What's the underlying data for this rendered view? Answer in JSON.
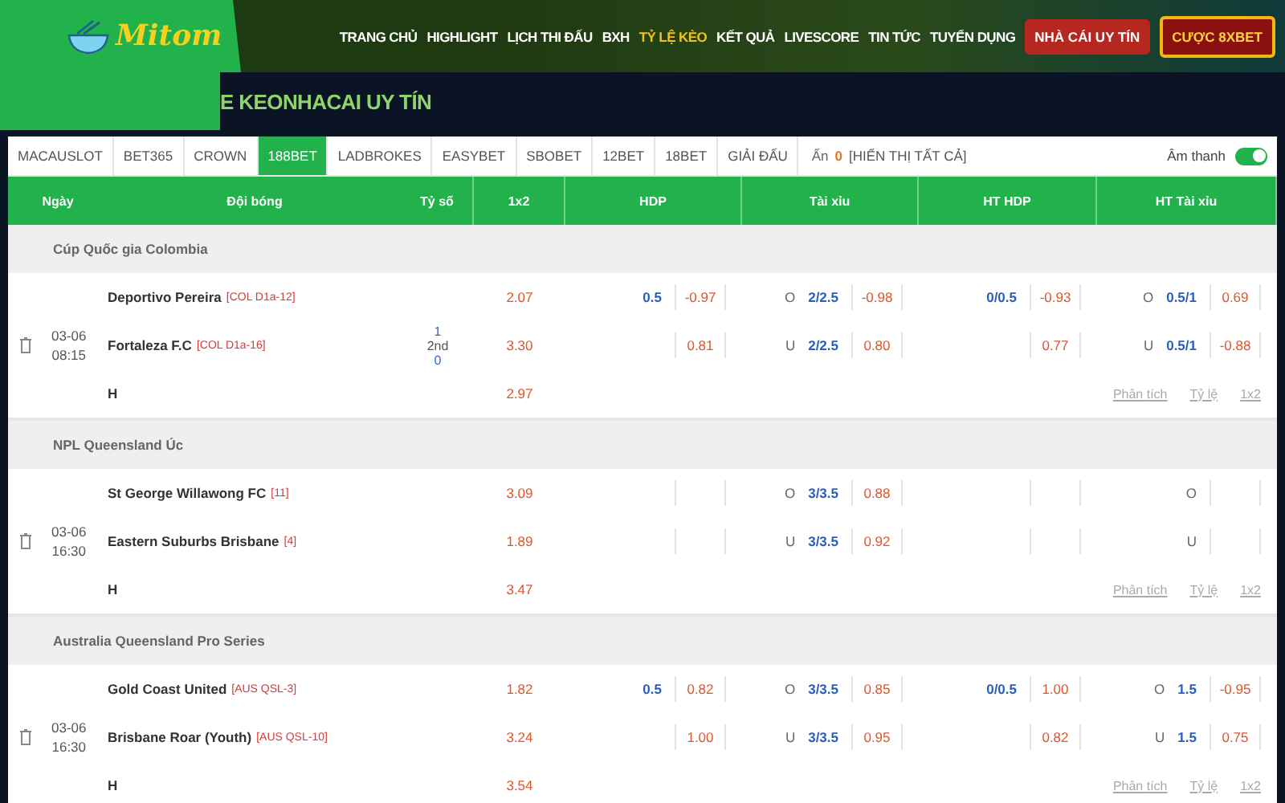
{
  "logo": {
    "text": "Mitom"
  },
  "nav": [
    {
      "label": "TRANG CHỦ",
      "selected": false
    },
    {
      "label": "HIGHLIGHT",
      "selected": false
    },
    {
      "label": "LỊCH THI ĐẤU",
      "selected": false
    },
    {
      "label": "BXH",
      "selected": false
    },
    {
      "label": "TỶ LỆ KÈO",
      "selected": true
    },
    {
      "label": "KẾT QUẢ",
      "selected": false
    },
    {
      "label": "LIVESCORE",
      "selected": false
    },
    {
      "label": "TIN TỨC",
      "selected": false
    },
    {
      "label": "TUYỂN DỤNG",
      "selected": false
    }
  ],
  "header_buttons": [
    {
      "label": "NHÀ CÁI UY TÍN",
      "kind": "primary"
    },
    {
      "label": "CƯỢC 8XBET",
      "kind": "promo"
    }
  ],
  "banner": {
    "title": "E KEONHACAI UY TÍN"
  },
  "tabs": [
    {
      "label": "MACAUSLOT",
      "selected": false
    },
    {
      "label": "BET365",
      "selected": false
    },
    {
      "label": "CROWN",
      "selected": false
    },
    {
      "label": "188BET",
      "selected": true
    },
    {
      "label": "LADBROKES",
      "selected": false
    },
    {
      "label": "EASYBET",
      "selected": false
    },
    {
      "label": "SBOBET",
      "selected": false
    },
    {
      "label": "12BET",
      "selected": false
    },
    {
      "label": "18BET",
      "selected": false
    },
    {
      "label": "GIẢI ĐẤU",
      "selected": false
    }
  ],
  "hidden": {
    "label": "Ẩn",
    "count": "0",
    "show_all": "[HIỂN THỊ TẤT CẢ]"
  },
  "sound": {
    "label": "Âm thanh",
    "on": true
  },
  "table": {
    "columns": [
      "Ngày",
      "Đội bóng",
      "Tỷ số",
      "1x2",
      "HDP",
      "Tài xỉu",
      "HT HDP",
      "HT Tài xỉu"
    ],
    "leagues": [
      {
        "name": "Cúp Quốc gia Colombia",
        "matches": [
          {
            "date": "03-06",
            "time": "08:15",
            "teams": [
              {
                "name": "Deportivo Pereira",
                "rank": "[COL D1a-12]"
              },
              {
                "name": "Fortaleza F.C",
                "rank": "[COL D1a-16]"
              }
            ],
            "draw": "H",
            "score": {
              "home": "1",
              "period": "2nd",
              "away": "0"
            },
            "odds_1x2": [
              "2.07",
              "3.30",
              "2.97"
            ],
            "hdp": [
              {
                "line": "0.5",
                "odds": "-0.97"
              },
              {
                "odds": "0.81"
              }
            ],
            "ou": [
              {
                "side": "O",
                "line": "2/2.5",
                "odds": "-0.98"
              },
              {
                "side": "U",
                "line": "2/2.5",
                "odds": "0.80"
              }
            ],
            "ht_hdp": [
              {
                "line": "0/0.5",
                "odds": "-0.93"
              },
              {
                "odds": "0.77"
              }
            ],
            "ht_ou": [
              {
                "side": "O",
                "line": "0.5/1",
                "odds": "0.69"
              },
              {
                "side": "U",
                "line": "0.5/1",
                "odds": "-0.88"
              }
            ],
            "links": [
              "Phân tích",
              "Tỷ lệ",
              "1x2"
            ]
          }
        ]
      },
      {
        "name": "NPL Queensland Úc",
        "matches": [
          {
            "date": "03-06",
            "time": "16:30",
            "teams": [
              {
                "name": "St George Willawong FC",
                "rank": "[11]"
              },
              {
                "name": "Eastern Suburbs Brisbane",
                "rank": "[4]"
              }
            ],
            "draw": "H",
            "odds_1x2": [
              "3.09",
              "1.89",
              "3.47"
            ],
            "ou": [
              {
                "side": "O",
                "line": "3/3.5",
                "odds": "0.88"
              },
              {
                "side": "U",
                "line": "3/3.5",
                "odds": "0.92"
              }
            ],
            "ht_ou": [
              {
                "side": "O"
              },
              {
                "side": "U"
              }
            ],
            "links": [
              "Phân tích",
              "Tỷ lệ",
              "1x2"
            ]
          }
        ]
      },
      {
        "name": "Australia Queensland Pro Series",
        "matches": [
          {
            "date": "03-06",
            "time": "16:30",
            "teams": [
              {
                "name": "Gold Coast United",
                "rank": "[AUS QSL-3]"
              },
              {
                "name": "Brisbane Roar (Youth)",
                "rank": "[AUS QSL-10]"
              }
            ],
            "draw": "H",
            "odds_1x2": [
              "1.82",
              "3.24",
              "3.54"
            ],
            "hdp": [
              {
                "line": "0.5",
                "odds": "0.82"
              },
              {
                "odds": "1.00"
              }
            ],
            "ou": [
              {
                "side": "O",
                "line": "3/3.5",
                "odds": "0.85"
              },
              {
                "side": "U",
                "line": "3/3.5",
                "odds": "0.95"
              }
            ],
            "ht_hdp": [
              {
                "line": "0/0.5",
                "odds": "1.00"
              },
              {
                "odds": "0.82"
              }
            ],
            "ht_ou": [
              {
                "side": "O",
                "line": "1.5",
                "odds": "-0.95"
              },
              {
                "side": "U",
                "line": "1.5",
                "odds": "0.75"
              }
            ],
            "links": [
              "Phân tích",
              "Tỷ lệ",
              "1x2"
            ]
          }
        ]
      }
    ]
  }
}
